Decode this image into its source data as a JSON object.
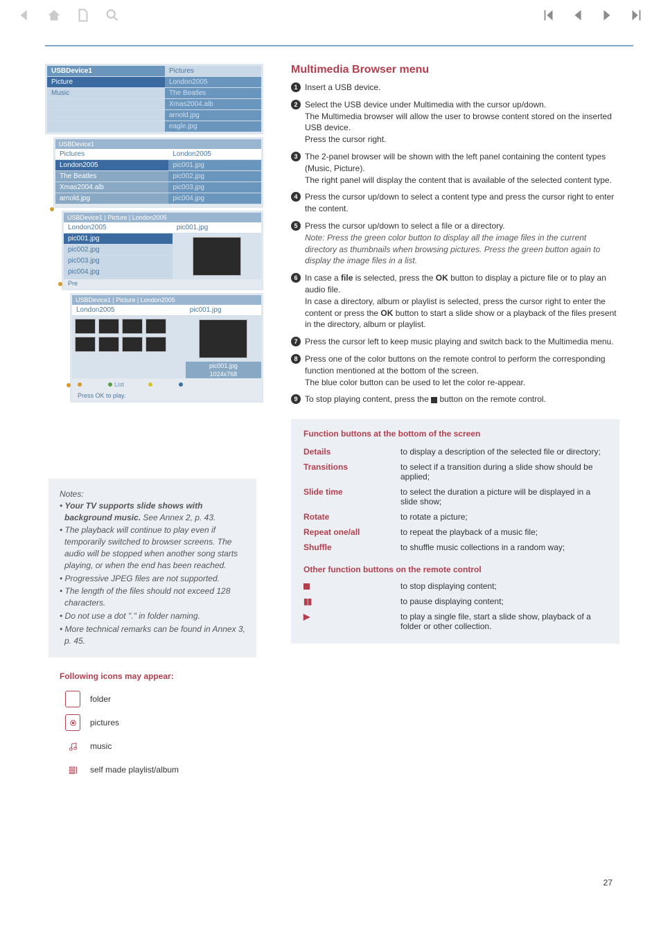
{
  "header": {
    "page_number": "27"
  },
  "screenshots": {
    "s1": {
      "left_hdr": "USBDevice1",
      "right_hdr": "Pictures",
      "l1": "Picture",
      "l2": "Music",
      "r1": "London2005",
      "r2": "The Beatles",
      "r3": "Xmas2004.alb",
      "r4": "arnold.jpg",
      "r5": "eagle.jpg"
    },
    "s2": {
      "crumb": "USBDevice1",
      "left_hdr": "Pictures",
      "right_hdr": "London2005",
      "l1": "London2005",
      "l2": "The Beatles",
      "l3": "Xmas2004.alb",
      "l4": "arnold.jpg",
      "r1": "pic001.jpg",
      "r2": "pic002.jpg",
      "r3": "pic003.jpg",
      "r4": "pic004.jpg"
    },
    "s3": {
      "crumb": "USBDevice1  |  Picture  |  London2005",
      "left_hdr": "London2005",
      "right_hdr": "pic001.jpg",
      "l1": "pic001.jpg",
      "l2": "pic002.jpg",
      "l3": "pic003.jpg",
      "l4": "pic004.jpg",
      "press": "Pre"
    },
    "s4": {
      "crumb": "USBDevice1  |  Picture  |  London2005",
      "left_hdr": "London2005",
      "right_hdr": "pic001.jpg",
      "overlay": "pic001.jpg",
      "overlay2": "1024x768",
      "foot_list": "List",
      "foot_press": "Press OK to play."
    }
  },
  "main": {
    "title": "Multimedia Browser menu",
    "steps": [
      "Insert a USB device.",
      "Select the USB device under Multimedia with the cursor up/down.\nThe Multimedia browser will allow the user to browse content stored on the inserted USB device.\nPress the cursor right.",
      "The 2-panel browser will be shown with the left panel containing the content types (Music, Picture).\nThe right panel will display the content that is available of the selected content type.",
      "Press the cursor up/down to select a content type and press the cursor right to enter the content.",
      "Press the cursor up/down to select a file or a directory.",
      "",
      "Press the cursor left to keep music playing and switch back to the Multimedia menu.",
      "Press one of the color buttons on the remote control to perform the corresponding function mentioned at the bottom of the screen.\nThe blue color button can be used to let the color re-appear.",
      ""
    ],
    "step5_note": "Note: Press the green color button to display all the image files in the current directory as thumbnails when browsing pictures. Press the green button again to display the image files in a list.",
    "step6_a": "In case a ",
    "step6_file": "file",
    "step6_b": " is selected, press the ",
    "step6_ok": "OK",
    "step6_c": " button to display a picture file or to play an audio file.",
    "step6_d": "In case a directory, album or playlist is selected, press the cursor right to enter the content or press the ",
    "step6_e": " button to start a slide show or a playback of the files present in the directory, album or playlist.",
    "step9_a": "To stop playing content, press the ",
    "step9_b": " button on the remote control."
  },
  "notes": {
    "heading": "Notes:",
    "n1a": "Your TV supports slide shows with background music.",
    "n1b": "  See Annex 2, p. 43.",
    "n2": "The playback will continue to play even if temporarily switched to browser screens. The audio will be stopped when another song starts playing, or when the end has been reached.",
    "n3": "Progressive JPEG files are not supported.",
    "n4": "The length of the files should not exceed 128 characters.",
    "n5": "Do not use a dot \".\" in folder naming.",
    "n6": "More technical remarks can be found in Annex 3, p. 45."
  },
  "icons": {
    "heading": "Following icons may appear:",
    "folder": "folder",
    "pictures": "pictures",
    "music": "music",
    "playlist": "self made playlist/album"
  },
  "fn": {
    "title1": "Function buttons at the bottom of the screen",
    "rows": [
      {
        "l": "Details",
        "r": "to display a description of the selected file or directory;"
      },
      {
        "l": "Transitions",
        "r": "to select if a transition during a slide show should be applied;"
      },
      {
        "l": "Slide time",
        "r": "to select the duration a picture will be displayed in a slide show;"
      },
      {
        "l": "Rotate",
        "r": "to rotate a picture;"
      },
      {
        "l": "Repeat one/all",
        "r": "to repeat the playback of a music file;"
      },
      {
        "l": "Shuffle",
        "r": "to shuffle music collections in a random way;"
      }
    ],
    "title2": "Other function buttons on the remote control",
    "other": [
      {
        "sym": "stop",
        "r": "to stop displaying content;"
      },
      {
        "sym": "pause",
        "r": "to pause displaying content;"
      },
      {
        "sym": "play",
        "r": "to play a single file, start a slide show, playback of a folder or other collection."
      }
    ]
  }
}
